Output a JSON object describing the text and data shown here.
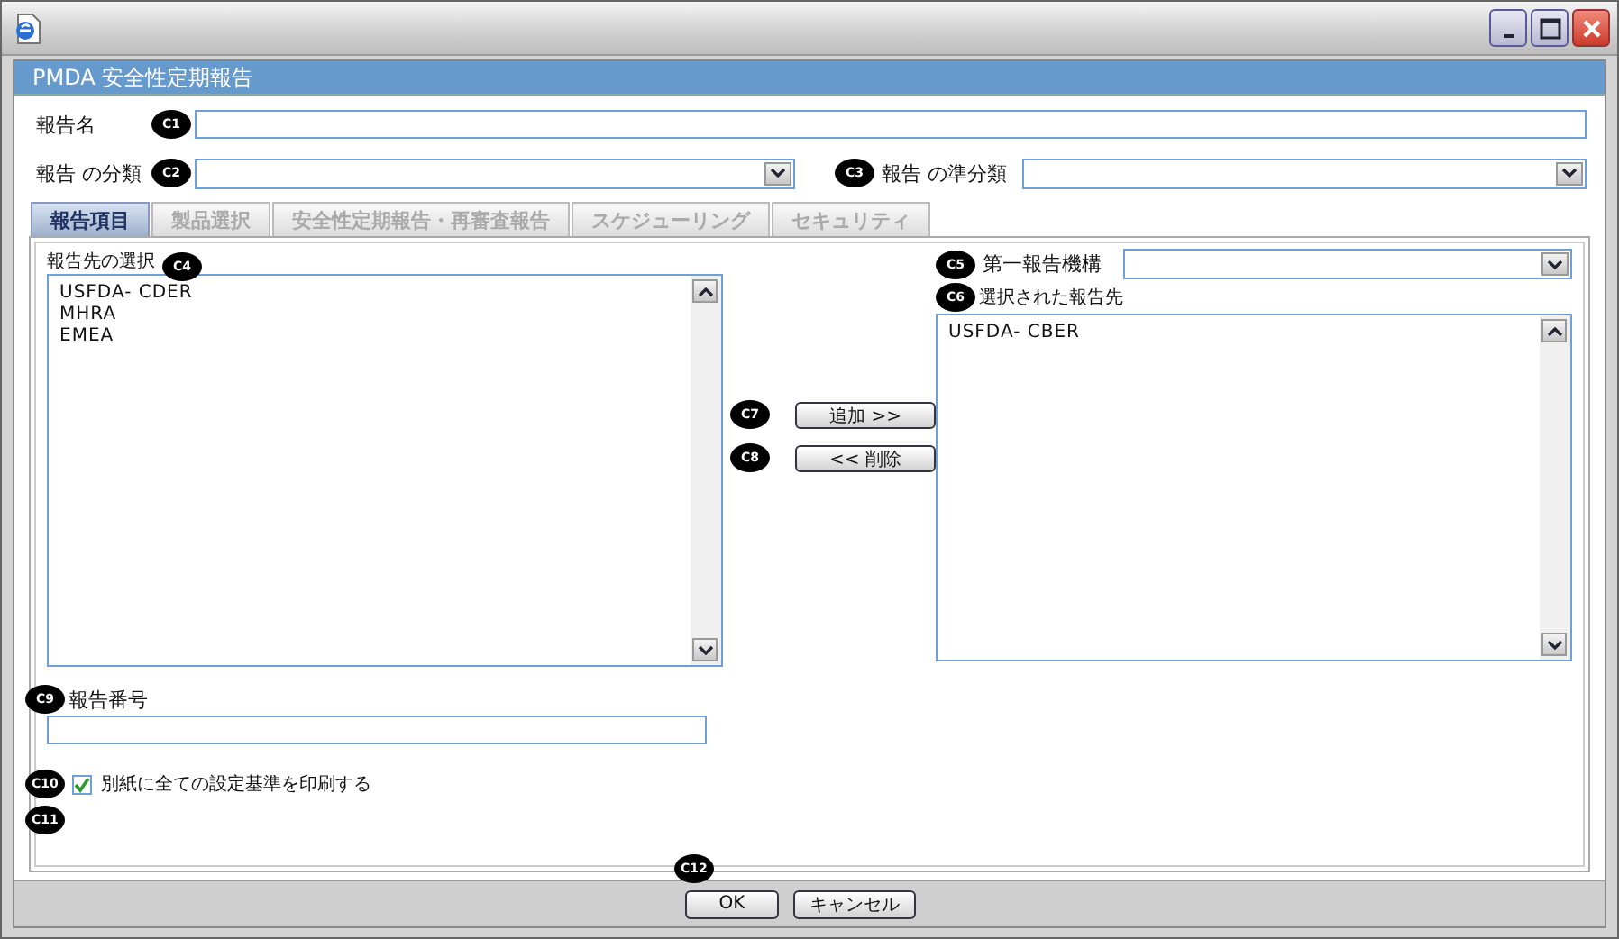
{
  "dialog": {
    "title": "PMDA 安全性定期報告"
  },
  "report_name": {
    "label": "報告名",
    "callout": "C1"
  },
  "category": {
    "label": "報告 の分類",
    "callout": "C2"
  },
  "subcategory": {
    "label": "報告 の準分類",
    "callout": "C3"
  },
  "tabs": [
    {
      "label": "報告項目",
      "selected": true
    },
    {
      "label": "製品選択",
      "selected": false
    },
    {
      "label": "安全性定期報告・再審査報告",
      "selected": false
    },
    {
      "label": "スケジューリング",
      "selected": false
    },
    {
      "label": "セキュリティ",
      "selected": false
    }
  ],
  "destinations": {
    "label": "報告先の選択",
    "callout": "C4",
    "items": [
      "USFDA- CDER",
      "MHRA",
      "EMEA"
    ]
  },
  "primary_agency": {
    "label": "第一報告機構",
    "callout": "C5"
  },
  "selected_destinations": {
    "label": "選択された報告先",
    "callout": "C6",
    "items": [
      "USFDA- CBER"
    ]
  },
  "add_button": {
    "label": "追加 >>",
    "callout": "C7"
  },
  "remove_button": {
    "label": "<< 削除",
    "callout": "C8"
  },
  "report_number": {
    "label": "報告番号",
    "callout": "C9"
  },
  "print_criteria": {
    "label": "別紙に全ての設定基準を印刷する",
    "checked": true,
    "callout": "C10"
  },
  "extra_callout": "C11",
  "buttons": [
    {
      "label": "OK",
      "callout": "C12"
    },
    {
      "label": "キャンセル"
    }
  ]
}
